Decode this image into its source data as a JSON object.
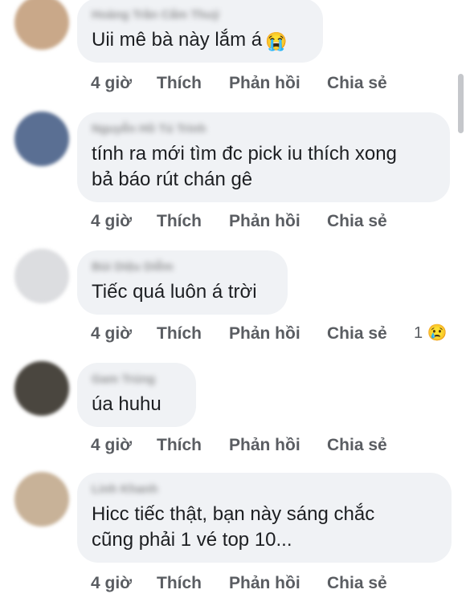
{
  "comments": [
    {
      "author": "Hoàng Trần Cẩm Thuỷ",
      "text_lines": [
        "Uii mê bà này lắm á"
      ],
      "emoji": "😭",
      "actions": {
        "time": "4 giờ",
        "like": "Thích",
        "reply": "Phản hồi",
        "share": "Chia sẻ"
      },
      "avatar_color": "#c9a889"
    },
    {
      "author": "Nguyễn Hồ Tú Trinh",
      "text_lines": [
        "tính ra mới tìm đc pick iu thích xong",
        "bả báo rút chán gê"
      ],
      "actions": {
        "time": "4 giờ",
        "like": "Thích",
        "reply": "Phản hồi",
        "share": "Chia sẻ"
      },
      "avatar_color": "#5a6f93"
    },
    {
      "author": "Bùi Diệu Diễm",
      "text_lines": [
        "Tiếc quá luôn á trời"
      ],
      "actions": {
        "time": "4 giờ",
        "like": "Thích",
        "reply": "Phản hồi",
        "share": "Chia sẻ"
      },
      "reaction": {
        "count": "1",
        "emoji": "😢"
      },
      "avatar_color": "#dcdde0"
    },
    {
      "author": "Gam Trúng",
      "text_lines": [
        "úa huhu"
      ],
      "actions": {
        "time": "4 giờ",
        "like": "Thích",
        "reply": "Phản hồi",
        "share": "Chia sẻ"
      },
      "avatar_color": "#4a463f"
    },
    {
      "author": "Linh Khanh",
      "text_lines": [
        "Hicc tiếc thật, bạn này sáng chắc",
        "cũng phải 1 vé top 10..."
      ],
      "actions": {
        "time": "4 giờ",
        "like": "Thích",
        "reply": "Phản hồi",
        "share": "Chia sẻ"
      },
      "avatar_color": "#c8b298"
    }
  ]
}
